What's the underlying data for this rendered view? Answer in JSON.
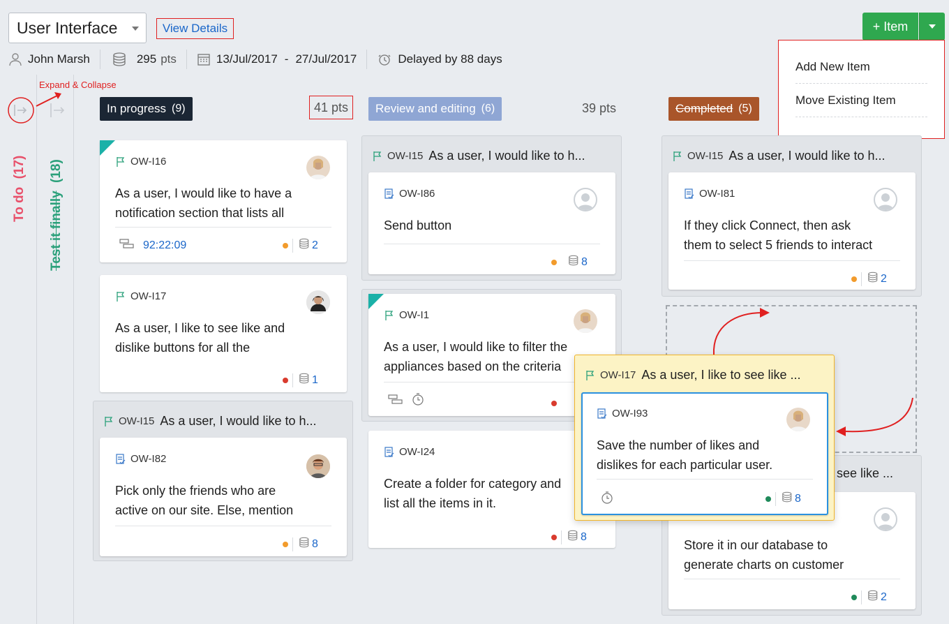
{
  "header": {
    "project": "User Interface",
    "view_details": "View Details",
    "owner": "John Marsh",
    "points": "295",
    "points_unit": "pts",
    "start_date": "13/Jul/2017",
    "date_sep": "-",
    "end_date": "27/Jul/2017",
    "status": "Delayed by 88 days"
  },
  "add": {
    "label": "+ Item"
  },
  "menu": {
    "items": [
      "Add New Item",
      "Move Existing Item"
    ]
  },
  "sidebar": {
    "note": "Expand & Collapse",
    "todo": "To do",
    "todo_count": "(17)",
    "test": "Test it finally",
    "test_count": "(18)"
  },
  "columns": [
    {
      "name": "In progress",
      "count": "(9)",
      "pts": "41 pts"
    },
    {
      "name": "Review and editing",
      "count": "(6)",
      "pts": "39 pts"
    },
    {
      "name": "Completed",
      "count": "(5)"
    }
  ],
  "cards": {
    "c1": {
      "id": "OW-I16",
      "line1": "As a user, I would like to have a",
      "line2": "notification section that lists all",
      "time": "92:22:09",
      "pts": "2"
    },
    "c2": {
      "id": "OW-I17",
      "line1": "As a user, I like to see like and",
      "line2": "dislike buttons for all the",
      "pts": "1"
    },
    "g1": {
      "id": "OW-I15",
      "title": "As a user, I would like to h..."
    },
    "c3": {
      "id": "OW-I82",
      "line1": "Pick only the friends who are",
      "line2": "active on our site. Else, mention",
      "pts": "8"
    },
    "g2": {
      "id": "OW-I15",
      "title": "As a user, I would like to h..."
    },
    "c4": {
      "id": "OW-I86",
      "line1": "Send button",
      "pts": "8"
    },
    "c5": {
      "id": "OW-I1",
      "line1": "As a user, I would like to filter the",
      "line2": "appliances based on the criteria"
    },
    "c6": {
      "id": "OW-I24",
      "line1": "Create a folder for category and",
      "line2": "list all the items in it.",
      "pts": "8"
    },
    "g3": {
      "id": "OW-I15",
      "title": "As a user, I would like to h..."
    },
    "c7": {
      "id": "OW-I81",
      "line1": "If they click Connect, then ask",
      "line2": "them to select 5 friends to interact",
      "pts": "2"
    },
    "g4": {
      "title": "see like ..."
    },
    "c8": {
      "line1": "Store it in our database to",
      "line2": "generate charts on customer",
      "pts": "2"
    },
    "drag_group": {
      "id": "OW-I17",
      "title": "As a user, I like to see like ..."
    },
    "c9": {
      "id": "OW-I93",
      "line1": "Save the number of likes and",
      "line2": "dislikes for each particular user.",
      "pts": "8"
    }
  },
  "colors": {
    "green": "#2fa84f",
    "dark": "#1b2634",
    "review": "#8fa6d4",
    "completed": "#a9552a",
    "link": "#1a66c9",
    "red_note": "#e02020",
    "todo": "#e8506a",
    "test": "#2aa07a"
  }
}
